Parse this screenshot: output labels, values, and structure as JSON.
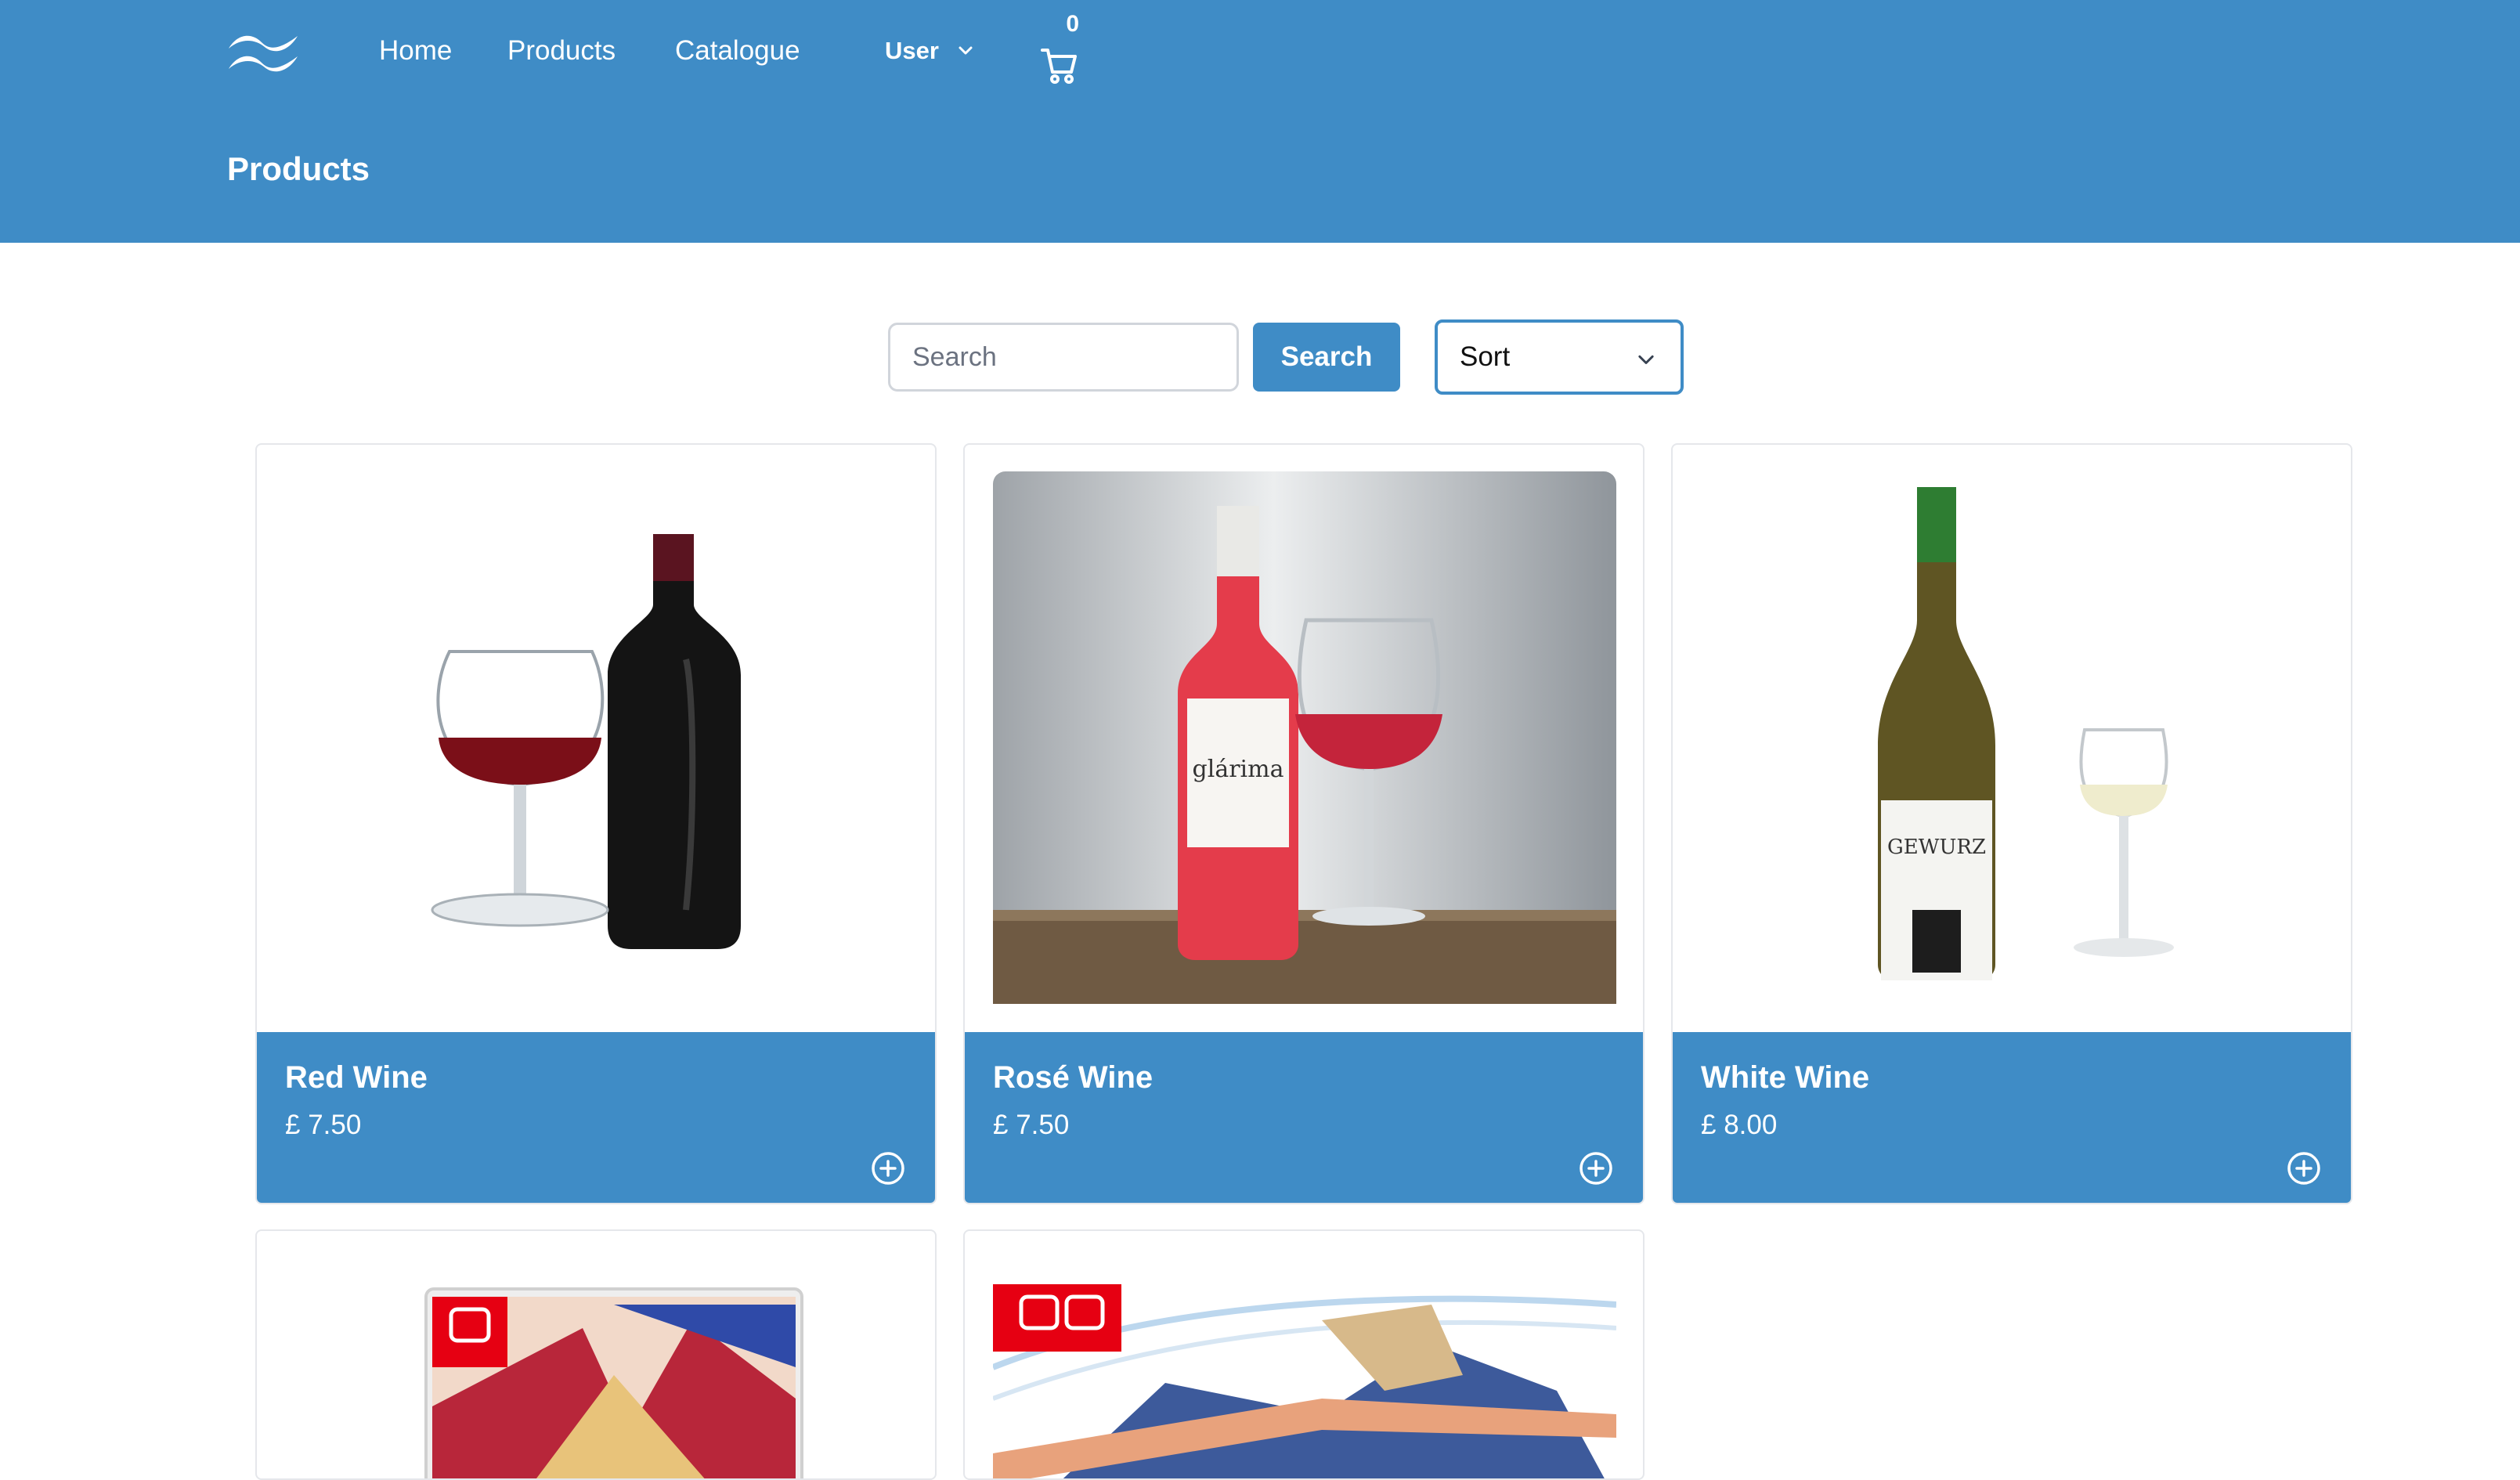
{
  "nav": {
    "home": "Home",
    "products": "Products",
    "catalogue": "Catalogue",
    "user": "User",
    "cart_count": "0"
  },
  "page": {
    "title": "Products"
  },
  "controls": {
    "search_placeholder": "Search",
    "search_button": "Search",
    "sort_label": "Sort"
  },
  "products": [
    {
      "name": "Red Wine",
      "price": "£ 7.50"
    },
    {
      "name": "Rosé Wine",
      "price": "£ 7.50"
    },
    {
      "name": "White Wine",
      "price": "£ 8.00"
    }
  ],
  "colors": {
    "brand": "#3f8cc6",
    "switch_red": "#e60012"
  },
  "icons": [
    "logo-icon",
    "chevron-down-icon",
    "cart-icon",
    "add-circle-icon"
  ]
}
